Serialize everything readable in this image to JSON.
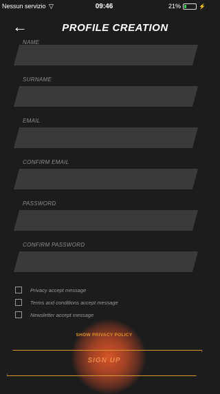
{
  "status_bar": {
    "carrier": "Nessun servizio",
    "time": "09:46",
    "battery_percent": "21%",
    "battery_level": 0.21,
    "icons": [
      "wifi-icon",
      "battery-icon",
      "charging-icon"
    ]
  },
  "header": {
    "title": "PROFILE CREATION",
    "back_icon": "arrow-left-icon"
  },
  "form": {
    "fields": [
      {
        "label": "NAME",
        "value": ""
      },
      {
        "label": "SURNAME",
        "value": ""
      },
      {
        "label": "EMAIL",
        "value": ""
      },
      {
        "label": "CONFIRM EMAIL",
        "value": ""
      },
      {
        "label": "PASSWORD",
        "value": ""
      },
      {
        "label": "CONFIRM PASSWORD",
        "value": ""
      }
    ],
    "checkboxes": [
      {
        "label": "Privacy accept message",
        "checked": false
      },
      {
        "label": "Terms and conditions accept message",
        "checked": false
      },
      {
        "label": "Newsletter accept message",
        "checked": false
      }
    ]
  },
  "links": {
    "privacy": "SHOW PRIVACY POLICY"
  },
  "actions": {
    "signup": "SIGN UP"
  },
  "colors": {
    "background": "#1c1c1c",
    "input": "#3a3a3a",
    "accent": "#e0922b",
    "glow": "#e05828"
  }
}
